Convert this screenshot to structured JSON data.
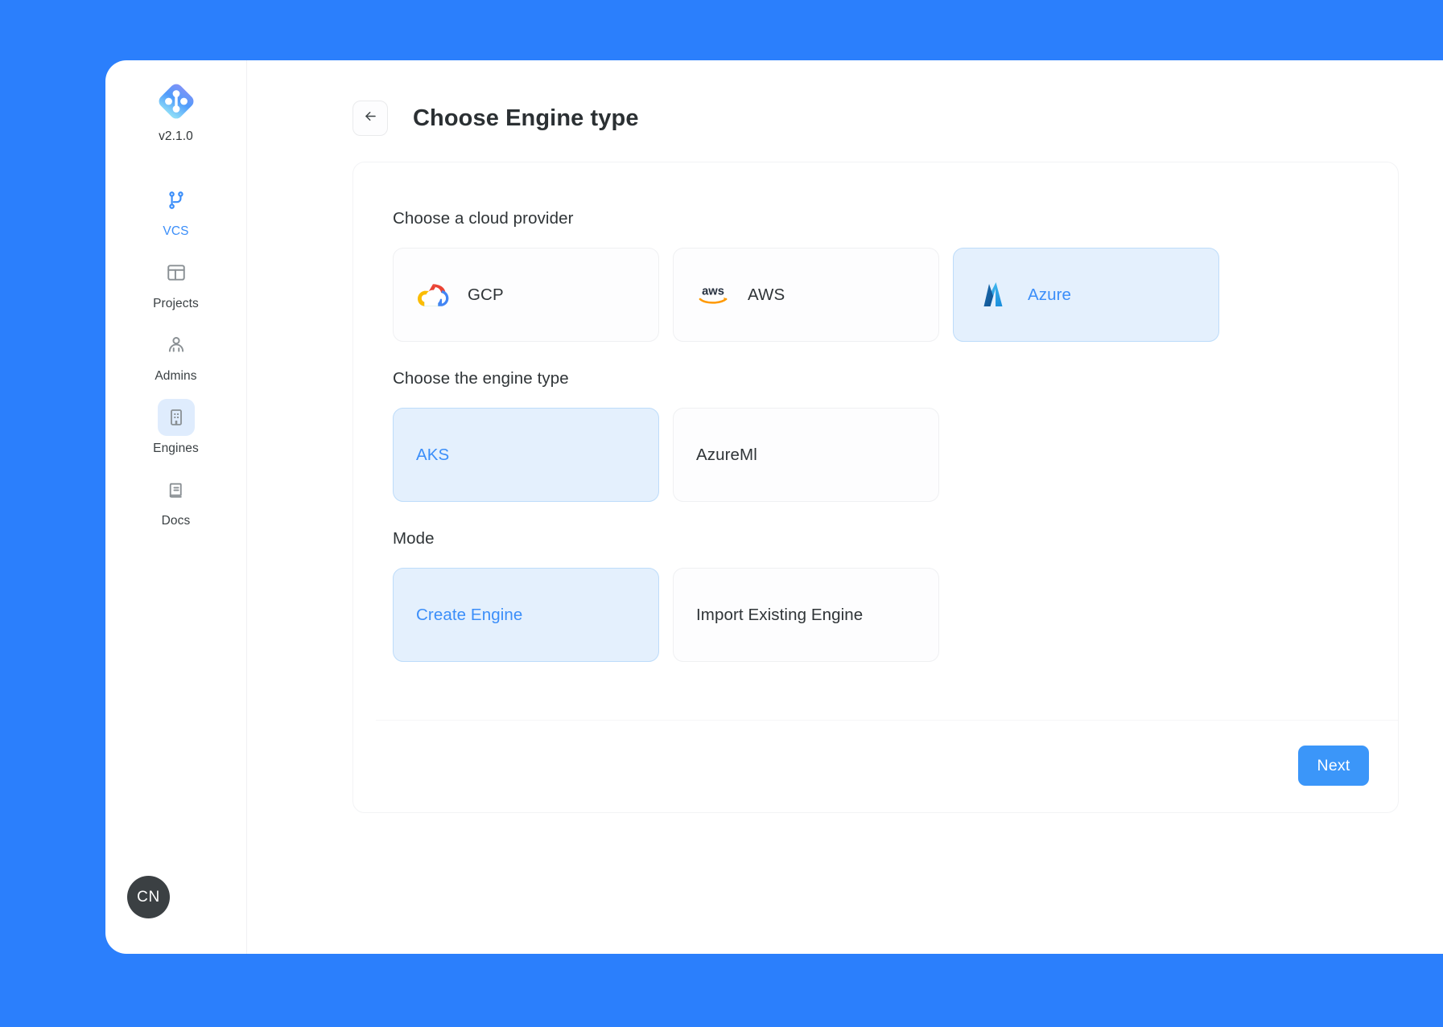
{
  "theme": {
    "background": "#2b7ffc",
    "panel": "#ffffff",
    "accent": "#3b8ef9",
    "selected_fill": "#e4f0fd",
    "selected_border": "#bddcfa",
    "next_button": "#3b96f9",
    "avatar_bg": "#3b4043",
    "text": "#2f3437"
  },
  "sidebar": {
    "version": "v2.1.0",
    "logo_icon": "app-diamond-logo",
    "items": [
      {
        "label": "VCS",
        "icon": "git-branch-icon",
        "active": false,
        "accent": true
      },
      {
        "label": "Projects",
        "icon": "layout-icon",
        "active": false,
        "accent": false
      },
      {
        "label": "Admins",
        "icon": "user-icon",
        "active": false,
        "accent": false
      },
      {
        "label": "Engines",
        "icon": "building-icon",
        "active": true,
        "accent": false
      },
      {
        "label": "Docs",
        "icon": "book-icon",
        "active": false,
        "accent": false
      }
    ],
    "avatar": {
      "initials": "CN"
    }
  },
  "header": {
    "back_icon": "arrow-left-icon",
    "title": "Choose Engine type"
  },
  "main": {
    "sections": [
      {
        "key": "cloud_provider",
        "label": "Choose a cloud provider",
        "options": [
          {
            "label": "GCP",
            "icon": "gcp-logo",
            "selected": false
          },
          {
            "label": "AWS",
            "icon": "aws-logo",
            "selected": false
          },
          {
            "label": "Azure",
            "icon": "azure-logo",
            "selected": true
          }
        ]
      },
      {
        "key": "engine_type",
        "label": "Choose the engine type",
        "options": [
          {
            "label": "AKS",
            "icon": "",
            "selected": true
          },
          {
            "label": "AzureMl",
            "icon": "",
            "selected": false
          }
        ]
      },
      {
        "key": "mode",
        "label": "Mode",
        "options": [
          {
            "label": "Create Engine",
            "icon": "",
            "selected": true
          },
          {
            "label": "Import Existing Engine",
            "icon": "",
            "selected": false
          }
        ]
      }
    ],
    "next_label": "Next"
  }
}
